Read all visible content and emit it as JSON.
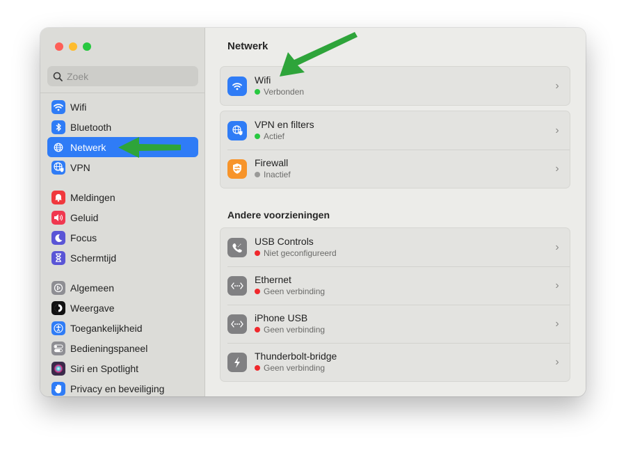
{
  "window": {
    "traffic_lights": [
      "close",
      "minimize",
      "zoom"
    ]
  },
  "sidebar": {
    "search": {
      "placeholder": "Zoek",
      "value": ""
    },
    "groups": [
      [
        {
          "label": "Wifi",
          "icon": "wifi-icon",
          "color": "#2f7cf6",
          "active": false
        },
        {
          "label": "Bluetooth",
          "icon": "bluetooth-icon",
          "color": "#2f7cf6",
          "active": false
        },
        {
          "label": "Netwerk",
          "icon": "globe-icon",
          "color": "#2f7cf6",
          "active": true
        },
        {
          "label": "VPN",
          "icon": "vpn-globe-icon",
          "color": "#2f7cf6",
          "active": false
        }
      ],
      [
        {
          "label": "Meldingen",
          "icon": "bell-icon",
          "color": "#f0383d",
          "active": false
        },
        {
          "label": "Geluid",
          "icon": "speaker-icon",
          "color": "#f0384f",
          "active": false
        },
        {
          "label": "Focus",
          "icon": "moon-icon",
          "color": "#5a55d6",
          "active": false
        },
        {
          "label": "Schermtijd",
          "icon": "hourglass-icon",
          "color": "#5a55d6",
          "active": false
        }
      ],
      [
        {
          "label": "Algemeen",
          "icon": "gear-icon",
          "color": "#8e8e93",
          "active": false
        },
        {
          "label": "Weergave",
          "icon": "display-icon",
          "color": "#111111",
          "active": false
        },
        {
          "label": "Toegankelijkheid",
          "icon": "accessibility-icon",
          "color": "#2f7cf6",
          "active": false
        },
        {
          "label": "Bedieningspaneel",
          "icon": "toggles-icon",
          "color": "#8e8e93",
          "active": false
        },
        {
          "label": "Siri en Spotlight",
          "icon": "siri-icon",
          "color": "#3a2a4a",
          "active": false
        },
        {
          "label": "Privacy en beveiliging",
          "icon": "hand-icon",
          "color": "#2f7cf6",
          "active": false
        }
      ]
    ]
  },
  "main": {
    "title": "Netwerk",
    "cards": [
      [
        {
          "title": "Wifi",
          "status": "Verbonden",
          "status_color": "#28c840",
          "icon": "wifi-icon",
          "color": "#2f7cf6"
        }
      ],
      [
        {
          "title": "VPN en filters",
          "status": "Actief",
          "status_color": "#28c840",
          "icon": "vpn-globe-icon",
          "color": "#2f7cf6"
        },
        {
          "title": "Firewall",
          "status": "Inactief",
          "status_color": "#9a9a98",
          "icon": "firewall-shield-icon",
          "color": "#f7942a"
        }
      ]
    ],
    "other_section_title": "Andere voorzieningen",
    "other": [
      {
        "title": "USB Controls",
        "status": "Niet geconfigureerd",
        "status_color": "#f0282c",
        "icon": "phone-icon",
        "color": "#808082"
      },
      {
        "title": "Ethernet",
        "status": "Geen verbinding",
        "status_color": "#f0282c",
        "icon": "ethernet-icon",
        "color": "#808082"
      },
      {
        "title": "iPhone USB",
        "status": "Geen verbinding",
        "status_color": "#f0282c",
        "icon": "ethernet-icon",
        "color": "#808082"
      },
      {
        "title": "Thunderbolt-bridge",
        "status": "Geen verbinding",
        "status_color": "#f0282c",
        "icon": "thunderbolt-icon",
        "color": "#808082"
      }
    ]
  },
  "annotations": {
    "arrow_color": "#2ea43a"
  }
}
